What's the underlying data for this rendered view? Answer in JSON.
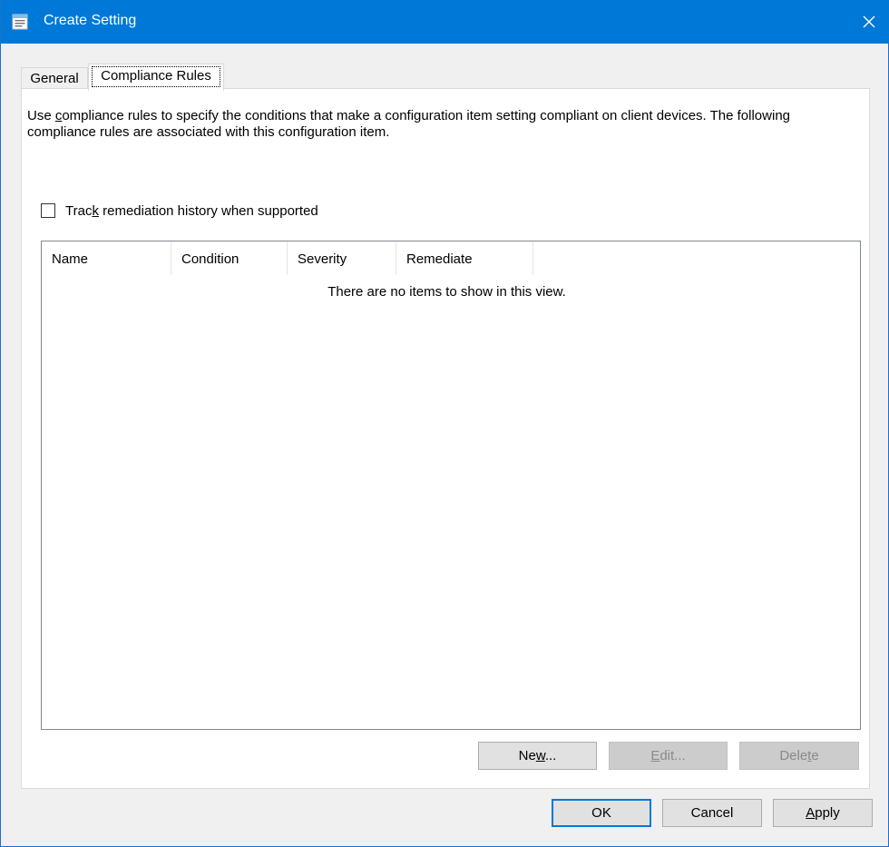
{
  "window": {
    "title": "Create Setting",
    "icon": "dialog-icon",
    "accent_color": "#0078d7"
  },
  "tabs": [
    {
      "label": "General",
      "active": false
    },
    {
      "label": "Compliance Rules",
      "active": true
    }
  ],
  "description": {
    "before_mnemonic": "Use ",
    "mnemonic": "c",
    "after_mnemonic": "ompliance rules to specify the conditions that make a configuration item setting compliant on client devices. The following compliance rules are associated with this configuration item."
  },
  "track_remediation": {
    "before_mnemonic": "Trac",
    "mnemonic": "k",
    "after_mnemonic": " remediation history when supported",
    "checked": false
  },
  "rules_list": {
    "columns": [
      "Name",
      "Condition",
      "Severity",
      "Remediate"
    ],
    "empty_message": "There are no items to show in this view."
  },
  "list_buttons": {
    "new": {
      "before": "Ne",
      "mnemonic": "w",
      "after": "..."
    },
    "edit": {
      "before": "",
      "mnemonic": "E",
      "after": "dit..."
    },
    "delete": {
      "before": "Dele",
      "mnemonic": "t",
      "after": "e"
    }
  },
  "dialog_buttons": {
    "ok": "OK",
    "cancel": "Cancel",
    "apply": {
      "before": "",
      "mnemonic": "A",
      "after": "pply"
    }
  }
}
